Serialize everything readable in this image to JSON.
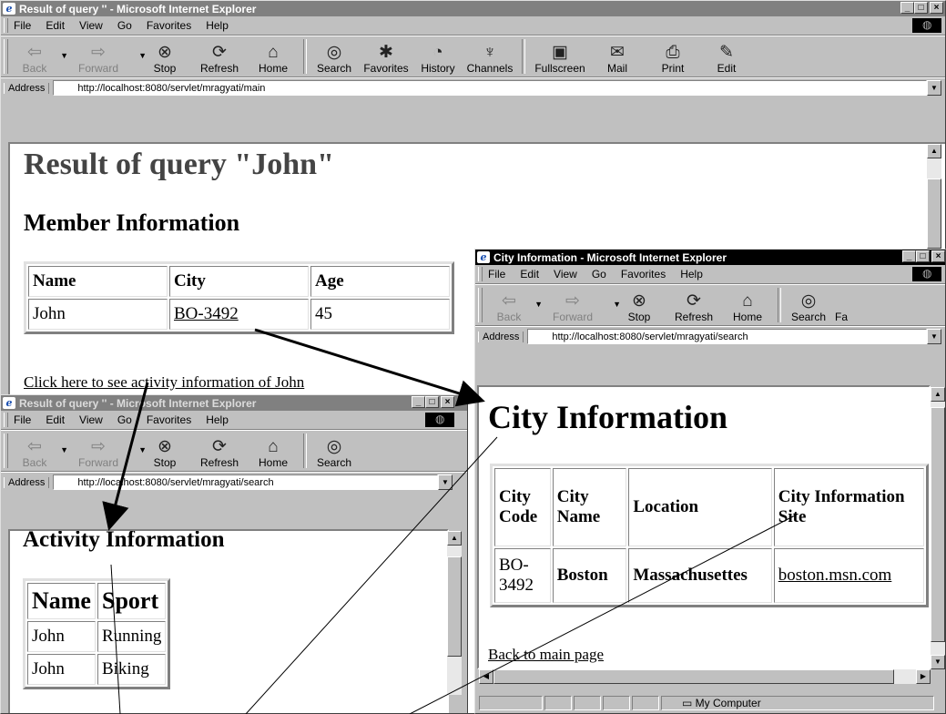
{
  "main_window": {
    "title": "Result of query '' - Microsoft Internet Explorer",
    "menu": [
      "File",
      "Edit",
      "View",
      "Go",
      "Favorites",
      "Help"
    ],
    "toolbar": [
      "Back",
      "Forward",
      "Stop",
      "Refresh",
      "Home",
      "Search",
      "Favorites",
      "History",
      "Channels",
      "Fullscreen",
      "Mail",
      "Print",
      "Edit"
    ],
    "address_label": "Address",
    "address": "http://localhost:8080/servlet/mragyati/main",
    "heading": "Result of query \"John\"",
    "subheading": "Member Information",
    "table_headers": [
      "Name",
      "City",
      "Age"
    ],
    "table_row": [
      "John",
      "BO-3492",
      "45"
    ],
    "activity_link": "Click here to see activity information of John"
  },
  "activity_window": {
    "title": "Result of query '' - Microsoft Internet Explorer",
    "menu": [
      "File",
      "Edit",
      "View",
      "Go",
      "Favorites",
      "Help"
    ],
    "toolbar": [
      "Back",
      "Forward",
      "Stop",
      "Refresh",
      "Home",
      "Search"
    ],
    "address_label": "Address",
    "address": "http://localhost:8080/servlet/mragyati/search",
    "heading": "Activity Information",
    "table_headers": [
      "Name",
      "Sport"
    ],
    "rows": [
      [
        "John",
        "Running"
      ],
      [
        "John",
        "Biking"
      ]
    ]
  },
  "city_window": {
    "title": "City Information - Microsoft Internet Explorer",
    "menu": [
      "File",
      "Edit",
      "View",
      "Go",
      "Favorites",
      "Help"
    ],
    "toolbar": [
      "Back",
      "Forward",
      "Stop",
      "Refresh",
      "Home",
      "Search",
      "Fa"
    ],
    "address_label": "Address",
    "address": "http://localhost:8080/servlet/mragyati/search",
    "heading": "City Information",
    "table_headers": [
      "City Code",
      "City Name",
      "Location",
      "City Information Site"
    ],
    "table_row": [
      "BO-3492",
      "Boston",
      "Massachusettes",
      "boston.msn.com"
    ],
    "back_link": "Back to main page",
    "status": "My Computer"
  },
  "window_controls": [
    "_",
    "□",
    "×"
  ]
}
